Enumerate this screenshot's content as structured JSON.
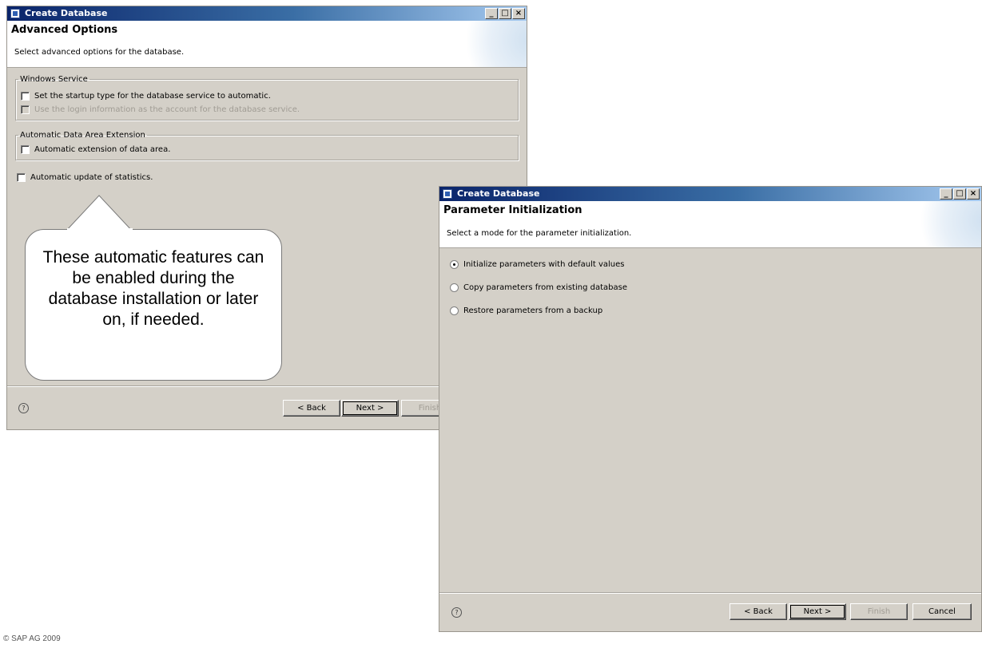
{
  "dialog_advanced": {
    "title": "Create Database",
    "win_buttons": [
      "_",
      "□",
      "×"
    ],
    "heading": "Advanced Options",
    "subtitle": "Select advanced options for the database.",
    "windows_service": {
      "legend": "Windows Service",
      "opt1": "Set the startup type for the database service to automatic.",
      "opt2": "Use the login information as the account for the database service."
    },
    "data_area": {
      "legend": "Automatic Data Area Extension",
      "opt1": "Automatic extension of data area."
    },
    "stats_option": "Automatic update of statistics.",
    "help": "?",
    "back": "< Back",
    "next": "Next >",
    "finish": "Finish"
  },
  "callout": {
    "text": "These automatic features can be enabled during the database installation or later on, if needed."
  },
  "dialog_param": {
    "title": "Create Database",
    "win_buttons": [
      "_",
      "□",
      "×"
    ],
    "heading": "Parameter Initialization",
    "subtitle": "Select a mode for the parameter initialization.",
    "options": [
      {
        "label": "Initialize parameters with default values",
        "selected": true
      },
      {
        "label": "Copy parameters from existing database",
        "selected": false
      },
      {
        "label": "Restore parameters from a backup",
        "selected": false
      }
    ],
    "help": "?",
    "back": "< Back",
    "next": "Next >",
    "finish": "Finish",
    "cancel": "Cancel"
  },
  "copyright": "© SAP AG 2009",
  "colors": {
    "dialog_bg": "#d4d0c8",
    "titlebar_start": "#0a246a",
    "titlebar_end": "#a6caf0"
  }
}
